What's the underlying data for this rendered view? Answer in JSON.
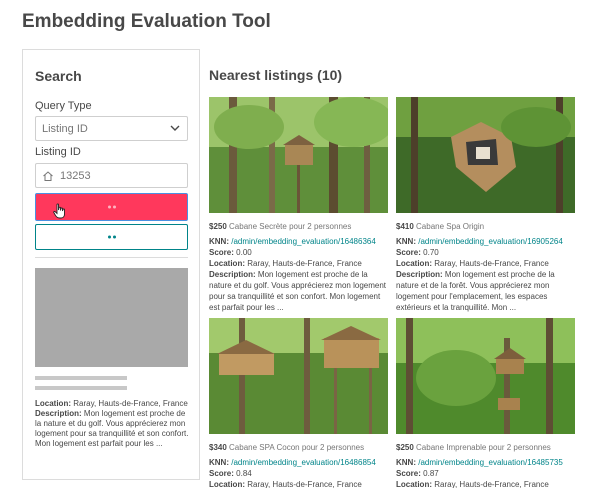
{
  "app": {
    "title": "Embedding Evaluation Tool"
  },
  "search": {
    "title": "Search",
    "query_type_label": "Query Type",
    "query_type_value": "Listing ID",
    "listing_id_label": "Listing ID",
    "listing_id_value": "13253",
    "result": {
      "location_label": "Location:",
      "location": "Raray, Hauts-de-France, France",
      "description_label": "Description:",
      "description": "Mon logement est proche de la nature et du golf. Vous apprécierez mon logement pour sa tranquillité et son confort. Mon logement est parfait pour les ..."
    }
  },
  "listings": {
    "title": "Nearest listings (10)",
    "items": [
      {
        "price": "$250",
        "name": "Cabane Secrète pour 2 personnes",
        "knn_label": "KNN:",
        "knn_link": "/admin/embedding_evaluation/16486364",
        "score_label": "Score:",
        "score": "0.00",
        "location_label": "Location:",
        "location": "Raray, Hauts-de-France, France",
        "description_label": "Description:",
        "description": "Mon logement est proche de la nature et du golf. Vous apprécierez mon logement pour sa tranquillité et son confort. Mon logement est parfait pour les ..."
      },
      {
        "price": "$410",
        "name": "Cabane Spa Origin",
        "knn_label": "KNN:",
        "knn_link": "/admin/embedding_evaluation/16905264",
        "score_label": "Score:",
        "score": "0.70",
        "location_label": "Location:",
        "location": "Raray, Hauts-de-France, France",
        "description_label": "Description:",
        "description": "Mon logement est proche de la nature et de la forêt. Vous apprécierez mon logement pour l'emplacement, les espaces extérieurs et la tranquillité. Mon ..."
      },
      {
        "price": "$340",
        "name": "Cabane SPA Cocon pour 2 personnes",
        "knn_label": "KNN:",
        "knn_link": "/admin/embedding_evaluation/16486854",
        "score_label": "Score:",
        "score": "0.84",
        "location_label": "Location:",
        "location": "Raray, Hauts-de-France, France"
      },
      {
        "price": "$250",
        "name": "Cabane Imprenable pour 2 personnes",
        "knn_label": "KNN:",
        "knn_link": "/admin/embedding_evaluation/16485735",
        "score_label": "Score:",
        "score": "0.87",
        "location_label": "Location:",
        "location": "Raray, Hauts-de-France, France"
      }
    ]
  },
  "colors": {
    "primary": "#ff385c",
    "secondary": "#008489",
    "text": "#484848"
  },
  "icons": [
    "chevron-down-icon",
    "home-icon",
    "hand-cursor-icon"
  ]
}
